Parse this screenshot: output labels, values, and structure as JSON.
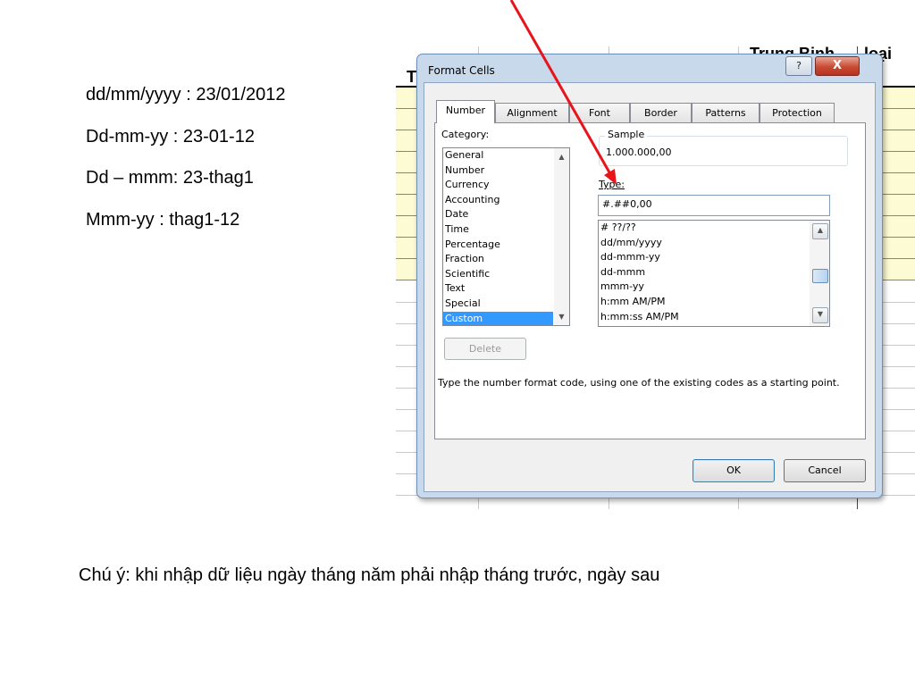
{
  "slide": {
    "lines": [
      "dd/mm/yyyy : 23/01/2012",
      "Dd-mm-yy : 23-01-12",
      "Dd – mmm: 23-thag1",
      "Mmm-yy : thag1-12"
    ],
    "note": "Chú ý: khi nhập dữ liệu ngày tháng năm phải nhập tháng trước, ngày sau"
  },
  "sheet": {
    "header_trung_binh": "Trung Binh",
    "header_loai": "loại",
    "header_t": "T"
  },
  "dialog": {
    "title": "Format Cells",
    "help_button": "?",
    "close_button": "X",
    "tabs": [
      "Number",
      "Alignment",
      "Font",
      "Border",
      "Patterns",
      "Protection"
    ],
    "active_tab": "Number",
    "category_label": "Category:",
    "categories": [
      "General",
      "Number",
      "Currency",
      "Accounting",
      "Date",
      "Time",
      "Percentage",
      "Fraction",
      "Scientific",
      "Text",
      "Special",
      "Custom"
    ],
    "selected_category": "Custom",
    "sample_label": "Sample",
    "sample_value": "1.000.000,00",
    "type_label": "Type:",
    "type_value": "#.##0,00",
    "type_list": [
      "# ??/??",
      "dd/mm/yyyy",
      "dd-mmm-yy",
      "dd-mmm",
      "mmm-yy",
      "h:mm AM/PM",
      "h:mm:ss AM/PM"
    ],
    "delete_button": "Delete",
    "description": "Type the number format code, using one of the existing codes as a starting point.",
    "ok_button": "OK",
    "cancel_button": "Cancel"
  },
  "colors": {
    "annotation_arrow": "#e8141b",
    "selection": "#3399ff",
    "sheet_row_fill": "#fdfbd3"
  }
}
